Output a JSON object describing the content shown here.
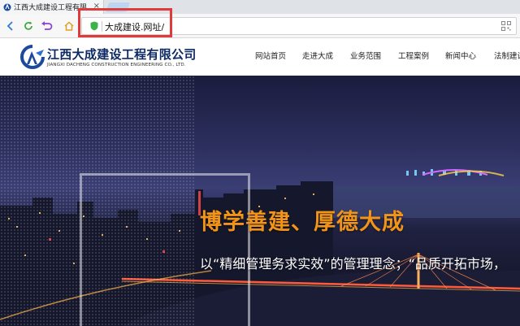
{
  "browser": {
    "tab_title": "江西大成建设工程有限",
    "tab_close": "×",
    "url": "大成建设.网址/",
    "icons": [
      "back-icon",
      "refresh-icon",
      "undo-icon",
      "home-icon",
      "shield-icon",
      "qr-icon"
    ]
  },
  "site": {
    "company_name": "江西大成建设工程有限公司",
    "company_name_en": "JIANGXI DACHENG CONSTRUCTION ENGINEERING CO., LTD.",
    "nav": [
      "网站首页",
      "走进大成",
      "业务范围",
      "工程案例",
      "新闻中心",
      "法制建设"
    ]
  },
  "hero": {
    "slogan": "博学善建、厚德大成",
    "tagline": "以“精细管理务求实效”的管理理念；“品质开拓市场，"
  },
  "colors": {
    "brand_blue": "#0d2a63",
    "slogan_orange": "#f29417",
    "highlight_red": "#e03b3b"
  }
}
